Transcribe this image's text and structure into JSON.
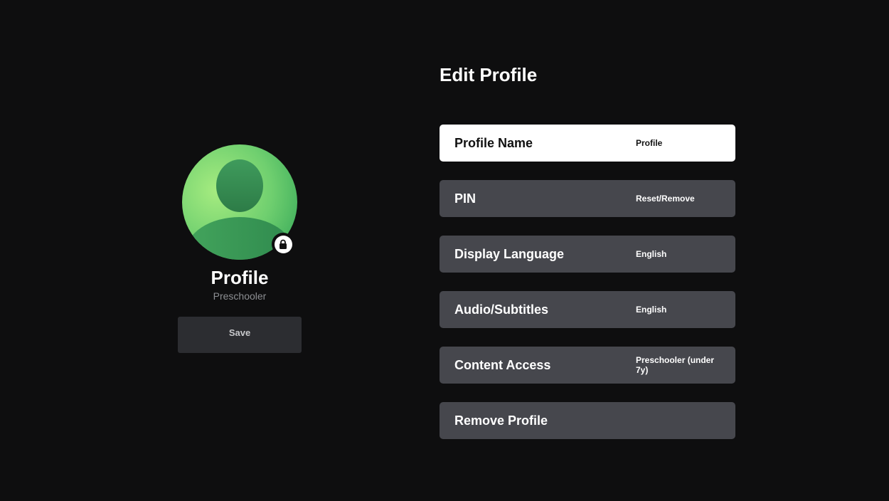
{
  "colors": {
    "background": "#0e0e0f",
    "row_background": "#46474d",
    "row_focused": "#ffffff",
    "save_button": "#2c2d31",
    "avatar_light": "#9ee47c",
    "avatar_dark": "#2f8a4e"
  },
  "profile": {
    "avatar_icon": "profile-avatar-icon",
    "lock_icon": "lock-icon",
    "name": "Profile",
    "type": "Preschooler",
    "save_label": "Save"
  },
  "edit": {
    "title": "Edit Profile",
    "rows": [
      {
        "label": "Profile Name",
        "value": "Profile",
        "focused": true
      },
      {
        "label": "PIN",
        "value": "Reset/Remove",
        "focused": false
      },
      {
        "label": "Display Language",
        "value": "English",
        "focused": false
      },
      {
        "label": "Audio/Subtitles",
        "value": "English",
        "focused": false
      },
      {
        "label": "Content Access",
        "value": "Preschooler (under 7y)",
        "focused": false
      },
      {
        "label": "Remove Profile",
        "value": "",
        "focused": false
      }
    ]
  }
}
